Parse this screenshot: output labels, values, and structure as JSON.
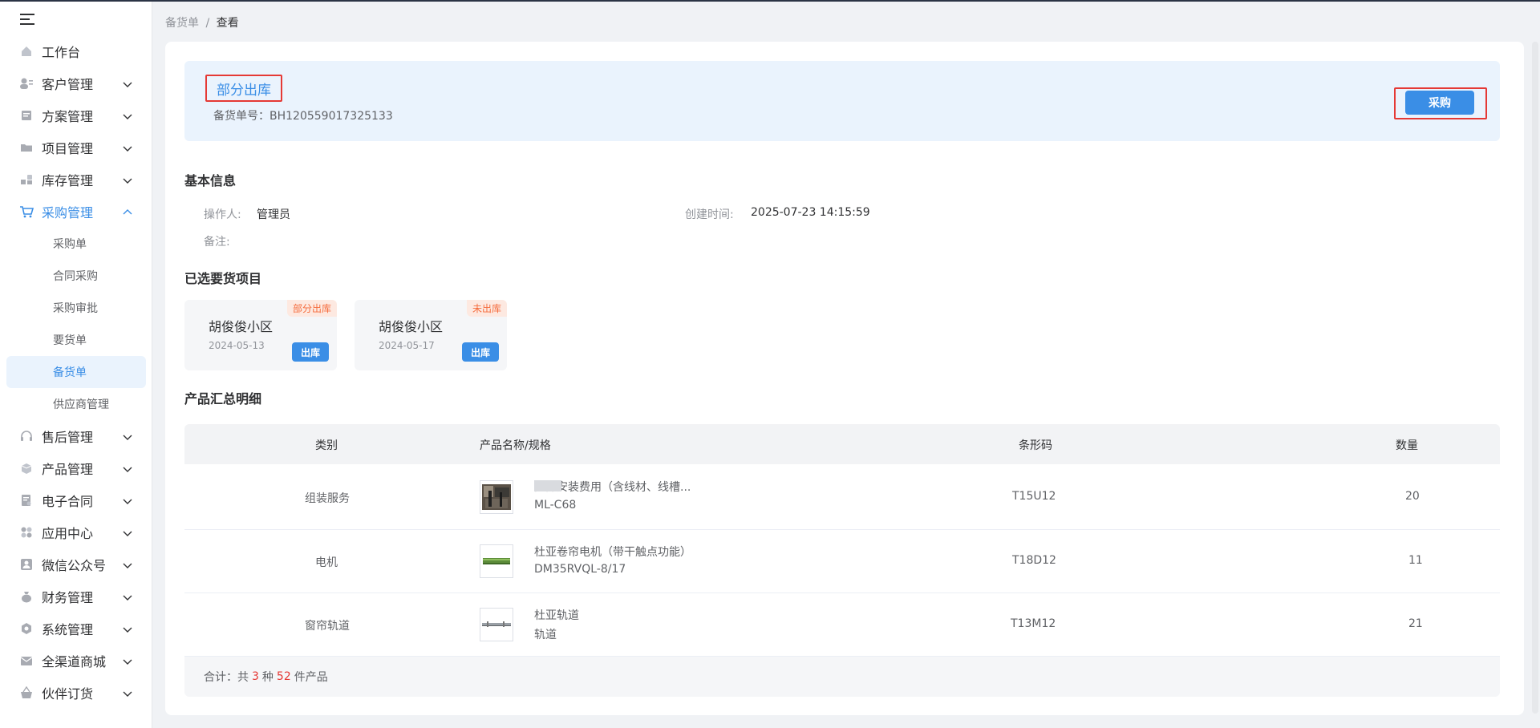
{
  "sidebar": {
    "items": [
      {
        "label": "工作台",
        "icon": "home-icon",
        "has_children": false
      },
      {
        "label": "客户管理",
        "icon": "customer-icon",
        "has_children": true
      },
      {
        "label": "方案管理",
        "icon": "document-icon",
        "has_children": true
      },
      {
        "label": "项目管理",
        "icon": "folder-icon",
        "has_children": true
      },
      {
        "label": "库存管理",
        "icon": "inventory-icon",
        "has_children": true
      },
      {
        "label": "采购管理",
        "icon": "cart-icon",
        "has_children": true,
        "expanded": true
      },
      {
        "label": "售后管理",
        "icon": "headset-icon",
        "has_children": true
      },
      {
        "label": "产品管理",
        "icon": "box-icon",
        "has_children": true
      },
      {
        "label": "电子合同",
        "icon": "contract-icon",
        "has_children": true
      },
      {
        "label": "应用中心",
        "icon": "apps-icon",
        "has_children": true
      },
      {
        "label": "微信公众号",
        "icon": "user-icon",
        "has_children": true
      },
      {
        "label": "财务管理",
        "icon": "money-bag-icon",
        "has_children": true
      },
      {
        "label": "系统管理",
        "icon": "settings-icon",
        "has_children": true
      },
      {
        "label": "全渠道商城",
        "icon": "mail-icon",
        "has_children": true
      },
      {
        "label": "伙伴订货",
        "icon": "basket-icon",
        "has_children": true
      }
    ],
    "purchase_subitems": [
      "采购单",
      "合同采购",
      "采购审批",
      "要货单",
      "备货单",
      "供应商管理"
    ],
    "selected_subitem": "备货单"
  },
  "breadcrumb": {
    "parent": "备货单",
    "separator": "/",
    "current": "查看"
  },
  "status": {
    "title": "部分出库",
    "order_no_label": "备货单号：",
    "order_no": "BH120559017325133",
    "purchase_button": "采购"
  },
  "basic_info": {
    "title": "基本信息",
    "operator_label": "操作人:",
    "operator": "管理员",
    "created_label": "创建时间:",
    "created": "2025-07-23 14:15:59",
    "remark_label": "备注:"
  },
  "projects": {
    "title": "已选要货项目",
    "cards": [
      {
        "name": "胡俊俊小区",
        "date": "2024-05-13",
        "badge": "部分出库",
        "button": "出库"
      },
      {
        "name": "胡俊俊小区",
        "date": "2024-05-17",
        "badge": "未出库",
        "button": "出库"
      }
    ]
  },
  "products": {
    "title": "产品汇总明细",
    "columns": [
      "类别",
      "产品名称/规格",
      "条形码",
      "数量"
    ],
    "rows": [
      {
        "category": "组装服务",
        "name": "内部安装费用（含线材、线槽...",
        "spec": "ML-C68",
        "barcode": "T15U12",
        "qty": "20",
        "thumb": "install-photo"
      },
      {
        "category": "电机",
        "name": "杜亚卷帘电机（带干触点功能）",
        "spec": "DM35RVQL-8/17",
        "barcode": "T18D12",
        "qty": "11",
        "thumb": "motor-photo"
      },
      {
        "category": "窗帘轨道",
        "name": "杜亚轨道",
        "spec": "轨道",
        "barcode": "T13M12",
        "qty": "21",
        "thumb": "track-photo"
      }
    ],
    "footer": {
      "prefix": "合计：共",
      "kinds": "3",
      "mid": "种",
      "total": "52",
      "suffix": "件产品"
    }
  },
  "colors": {
    "accent": "#3a8ee6",
    "highlight_border": "#e53935",
    "badge": "#f56c3d"
  }
}
